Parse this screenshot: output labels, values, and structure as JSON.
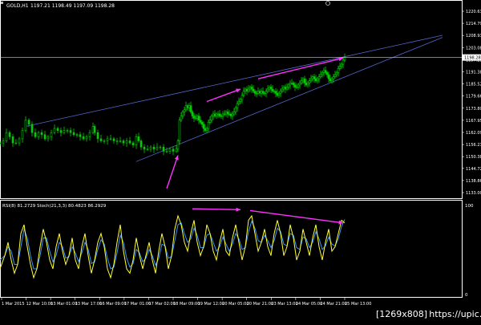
{
  "header": {
    "symbol": "GOLD,H1",
    "ohlc": "1197.21 1198.49 1197.09 1198.28",
    "current_price": "1198.28"
  },
  "indicator": {
    "label": "RSI(8) 81.2729  Stoch(21,3,3) 80.4823 86.2929",
    "levels": [
      "100",
      "0"
    ]
  },
  "watermark": "[1269x808] https://upic.me/",
  "colors": {
    "background": "#000000",
    "grid": "#ffffff",
    "candles": "#00cc00",
    "trendlines": "#5566cc",
    "annotation": "#ff33ff",
    "rsi": "#ffff33",
    "stoch": "#3399ff"
  },
  "chart_data": [
    {
      "type": "candlestick",
      "title": "GOLD,H1",
      "y_ticks": [
        "1220.63",
        "1214.79",
        "1208.93",
        "1203.08",
        "1197.23",
        "1191.38",
        "1185.52",
        "1179.66",
        "1173.80",
        "1167.95",
        "1162.09",
        "1156.23",
        "1150.38",
        "1144.72",
        "1138.86",
        "1133.00"
      ],
      "ylim": [
        1133.0,
        1220.63
      ],
      "x_ticks": [
        "1 Mar 2015",
        "12 Mar 10:00",
        "13 Mar 01:00",
        "13 Mar 17:00",
        "16 Mar 09:00",
        "17 Mar 01:00",
        "17 Mar 02:00",
        "18 Mar 09:00",
        "19 Mar 12:00",
        "20 Mar 05:00",
        "20 Mar 21:00",
        "23 Mar 13:00",
        "24 Mar 05:00",
        "24 Mar 21:00",
        "25 Mar 13:00"
      ],
      "close_path": [
        [
          0,
          1157
        ],
        [
          4,
          1158
        ],
        [
          8,
          1162
        ],
        [
          12,
          1160
        ],
        [
          16,
          1157
        ],
        [
          20,
          1157
        ],
        [
          24,
          1159
        ],
        [
          28,
          1163
        ],
        [
          32,
          1168
        ],
        [
          36,
          1166
        ],
        [
          40,
          1162
        ],
        [
          44,
          1160
        ],
        [
          48,
          1162
        ],
        [
          52,
          1161
        ],
        [
          56,
          1159
        ],
        [
          60,
          1160
        ],
        [
          64,
          1162
        ],
        [
          68,
          1164
        ],
        [
          72,
          1163
        ],
        [
          76,
          1162
        ],
        [
          80,
          1163
        ],
        [
          84,
          1163
        ],
        [
          88,
          1162
        ],
        [
          92,
          1161
        ],
        [
          96,
          1161
        ],
        [
          100,
          1160
        ],
        [
          104,
          1159
        ],
        [
          108,
          1160
        ],
        [
          112,
          1162
        ],
        [
          116,
          1165
        ],
        [
          118,
          1162
        ],
        [
          122,
          1159
        ],
        [
          126,
          1158
        ],
        [
          130,
          1158
        ],
        [
          134,
          1159
        ],
        [
          138,
          1159
        ],
        [
          142,
          1158
        ],
        [
          146,
          1158
        ],
        [
          150,
          1158
        ],
        [
          154,
          1157
        ],
        [
          158,
          1158
        ],
        [
          162,
          1157
        ],
        [
          166,
          1156
        ],
        [
          170,
          1160
        ],
        [
          173,
          1158
        ],
        [
          176,
          1155
        ],
        [
          180,
          1154
        ],
        [
          184,
          1154
        ],
        [
          188,
          1155
        ],
        [
          192,
          1154
        ],
        [
          196,
          1155
        ],
        [
          200,
          1155
        ],
        [
          204,
          1153
        ],
        [
          208,
          1153
        ],
        [
          212,
          1154
        ],
        [
          216,
          1153
        ],
        [
          220,
          1154
        ],
        [
          222,
          1158
        ],
        [
          224,
          1168
        ],
        [
          226,
          1170
        ],
        [
          228,
          1172
        ],
        [
          230,
          1173
        ],
        [
          232,
          1175
        ],
        [
          234,
          1174
        ],
        [
          236,
          1175
        ],
        [
          238,
          1172
        ],
        [
          240,
          1170
        ],
        [
          242,
          1169
        ],
        [
          244,
          1169
        ],
        [
          246,
          1170
        ],
        [
          248,
          1168
        ],
        [
          250,
          1167
        ],
        [
          252,
          1166
        ],
        [
          254,
          1164
        ],
        [
          256,
          1163
        ],
        [
          258,
          1164
        ],
        [
          260,
          1167
        ],
        [
          262,
          1168
        ],
        [
          264,
          1170
        ],
        [
          266,
          1171
        ],
        [
          268,
          1170
        ],
        [
          270,
          1171
        ],
        [
          272,
          1171
        ],
        [
          274,
          1170
        ],
        [
          276,
          1170
        ],
        [
          278,
          1171
        ],
        [
          280,
          1171
        ],
        [
          282,
          1172
        ],
        [
          284,
          1171
        ],
        [
          286,
          1171
        ],
        [
          288,
          1170
        ],
        [
          290,
          1171
        ],
        [
          292,
          1172
        ],
        [
          294,
          1174
        ],
        [
          296,
          1176
        ],
        [
          298,
          1177
        ],
        [
          300,
          1178
        ],
        [
          302,
          1180
        ],
        [
          304,
          1182
        ],
        [
          306,
          1183
        ],
        [
          308,
          1182
        ],
        [
          310,
          1183
        ],
        [
          312,
          1184
        ],
        [
          314,
          1183
        ],
        [
          316,
          1182
        ],
        [
          318,
          1181
        ],
        [
          320,
          1181
        ],
        [
          322,
          1182
        ],
        [
          324,
          1181
        ],
        [
          326,
          1182
        ],
        [
          328,
          1181
        ],
        [
          330,
          1181
        ],
        [
          332,
          1182
        ],
        [
          334,
          1183
        ],
        [
          336,
          1184
        ],
        [
          338,
          1183
        ],
        [
          340,
          1182
        ],
        [
          342,
          1182
        ],
        [
          344,
          1181
        ],
        [
          346,
          1180
        ],
        [
          348,
          1181
        ],
        [
          350,
          1182
        ],
        [
          352,
          1183
        ],
        [
          354,
          1184
        ],
        [
          356,
          1183
        ],
        [
          358,
          1184
        ],
        [
          360,
          1185
        ],
        [
          362,
          1186
        ],
        [
          364,
          1186
        ],
        [
          366,
          1185
        ],
        [
          368,
          1184
        ],
        [
          370,
          1184
        ],
        [
          372,
          1185
        ],
        [
          374,
          1186
        ],
        [
          376,
          1187
        ],
        [
          378,
          1188
        ],
        [
          380,
          1186
        ],
        [
          382,
          1185
        ],
        [
          384,
          1186
        ],
        [
          386,
          1187
        ],
        [
          388,
          1188
        ],
        [
          390,
          1189
        ],
        [
          392,
          1188
        ],
        [
          394,
          1187
        ],
        [
          396,
          1188
        ],
        [
          398,
          1189
        ],
        [
          400,
          1190
        ],
        [
          402,
          1191
        ],
        [
          404,
          1192
        ],
        [
          406,
          1191
        ],
        [
          408,
          1190
        ],
        [
          410,
          1188
        ],
        [
          412,
          1187
        ],
        [
          414,
          1188
        ],
        [
          416,
          1189
        ],
        [
          418,
          1190
        ],
        [
          420,
          1191
        ],
        [
          422,
          1193
        ],
        [
          424,
          1194
        ],
        [
          426,
          1195
        ],
        [
          428,
          1197
        ],
        [
          430,
          1198.3
        ]
      ],
      "trendlines": [
        {
          "from": [
            32,
            1165
          ],
          "to": [
            552,
            1209
          ]
        },
        {
          "from": [
            170,
            1148
          ],
          "to": [
            552,
            1208
          ]
        }
      ],
      "horizontal_line": 1198.28,
      "arrows": [
        {
          "from": [
            258,
            1177
          ],
          "to": [
            300,
            1183
          ]
        },
        {
          "from": [
            322,
            1188
          ],
          "to": [
            428,
            1198
          ]
        },
        {
          "from": [
            208,
            1135
          ],
          "to": [
            222,
            1151
          ]
        }
      ]
    },
    {
      "type": "line",
      "title": "RSI(8) 81.2729  Stoch(21,3,3) 80.4823 86.2929",
      "ylim": [
        0,
        100
      ],
      "series": [
        {
          "name": "RSI(8)",
          "color": "#ffff33",
          "x": [
            0,
            6,
            10,
            14,
            18,
            22,
            26,
            30,
            34,
            38,
            42,
            46,
            50,
            54,
            58,
            62,
            66,
            70,
            74,
            78,
            82,
            86,
            90,
            94,
            98,
            102,
            106,
            110,
            114,
            118,
            122,
            126,
            130,
            134,
            138,
            142,
            146,
            150,
            154,
            158,
            162,
            166,
            170,
            174,
            178,
            182,
            186,
            190,
            194,
            198,
            202,
            206,
            210,
            214,
            218,
            222,
            226,
            230,
            234,
            238,
            242,
            246,
            250,
            254,
            258,
            262,
            266,
            270,
            274,
            278,
            282,
            286,
            290,
            294,
            298,
            302,
            306,
            310,
            314,
            318,
            322,
            326,
            330,
            334,
            338,
            342,
            346,
            350,
            354,
            358,
            362,
            366,
            370,
            374,
            378,
            382,
            386,
            390,
            394,
            398,
            402,
            406,
            410,
            414,
            418,
            422,
            426,
            430
          ],
          "values": [
            30,
            45,
            60,
            40,
            25,
            35,
            70,
            80,
            55,
            35,
            20,
            30,
            55,
            75,
            60,
            40,
            30,
            55,
            70,
            50,
            35,
            45,
            65,
            40,
            30,
            55,
            70,
            45,
            25,
            40,
            60,
            70,
            55,
            30,
            20,
            35,
            60,
            80,
            50,
            30,
            25,
            40,
            65,
            45,
            30,
            45,
            60,
            40,
            25,
            50,
            70,
            55,
            30,
            45,
            75,
            90,
            80,
            60,
            50,
            70,
            85,
            60,
            45,
            55,
            80,
            70,
            50,
            40,
            60,
            75,
            50,
            45,
            65,
            80,
            60,
            40,
            55,
            85,
            90,
            70,
            50,
            60,
            75,
            55,
            45,
            70,
            85,
            70,
            45,
            55,
            80,
            65,
            40,
            50,
            75,
            60,
            45,
            65,
            80,
            55,
            40,
            60,
            75,
            50,
            55,
            70,
            85,
            82
          ]
        },
        {
          "name": "Stoch(21,3,3)",
          "color": "#3399ff",
          "x": [
            0,
            6,
            10,
            14,
            18,
            22,
            26,
            30,
            34,
            38,
            42,
            46,
            50,
            54,
            58,
            62,
            66,
            70,
            74,
            78,
            82,
            86,
            90,
            94,
            98,
            102,
            106,
            110,
            114,
            118,
            122,
            126,
            130,
            134,
            138,
            142,
            146,
            150,
            154,
            158,
            162,
            166,
            170,
            174,
            178,
            182,
            186,
            190,
            194,
            198,
            202,
            206,
            210,
            214,
            218,
            222,
            226,
            230,
            234,
            238,
            242,
            246,
            250,
            254,
            258,
            262,
            266,
            270,
            274,
            278,
            282,
            286,
            290,
            294,
            298,
            302,
            306,
            310,
            314,
            318,
            322,
            326,
            330,
            334,
            338,
            342,
            346,
            350,
            354,
            358,
            362,
            366,
            370,
            374,
            378,
            382,
            386,
            390,
            394,
            398,
            402,
            406,
            410,
            414,
            418,
            422,
            426,
            430
          ],
          "values": [
            40,
            45,
            55,
            50,
            35,
            35,
            55,
            75,
            65,
            45,
            30,
            30,
            45,
            65,
            65,
            50,
            38,
            45,
            60,
            55,
            42,
            44,
            55,
            48,
            38,
            48,
            60,
            52,
            36,
            38,
            52,
            63,
            58,
            42,
            30,
            32,
            48,
            68,
            60,
            42,
            32,
            36,
            52,
            48,
            38,
            42,
            52,
            45,
            34,
            42,
            58,
            56,
            42,
            44,
            62,
            80,
            82,
            70,
            60,
            64,
            76,
            68,
            54,
            54,
            68,
            70,
            60,
            50,
            55,
            66,
            58,
            50,
            58,
            70,
            64,
            52,
            54,
            72,
            84,
            76,
            62,
            60,
            68,
            62,
            54,
            62,
            76,
            72,
            58,
            56,
            70,
            68,
            54,
            52,
            66,
            64,
            54,
            60,
            72,
            64,
            52,
            56,
            66,
            58,
            56,
            64,
            78,
            86
          ]
        }
      ],
      "arrows": [
        {
          "from": [
            240,
            98
          ],
          "to": [
            300,
            97
          ]
        },
        {
          "from": [
            312,
            96
          ],
          "to": [
            428,
            82
          ]
        }
      ]
    }
  ]
}
